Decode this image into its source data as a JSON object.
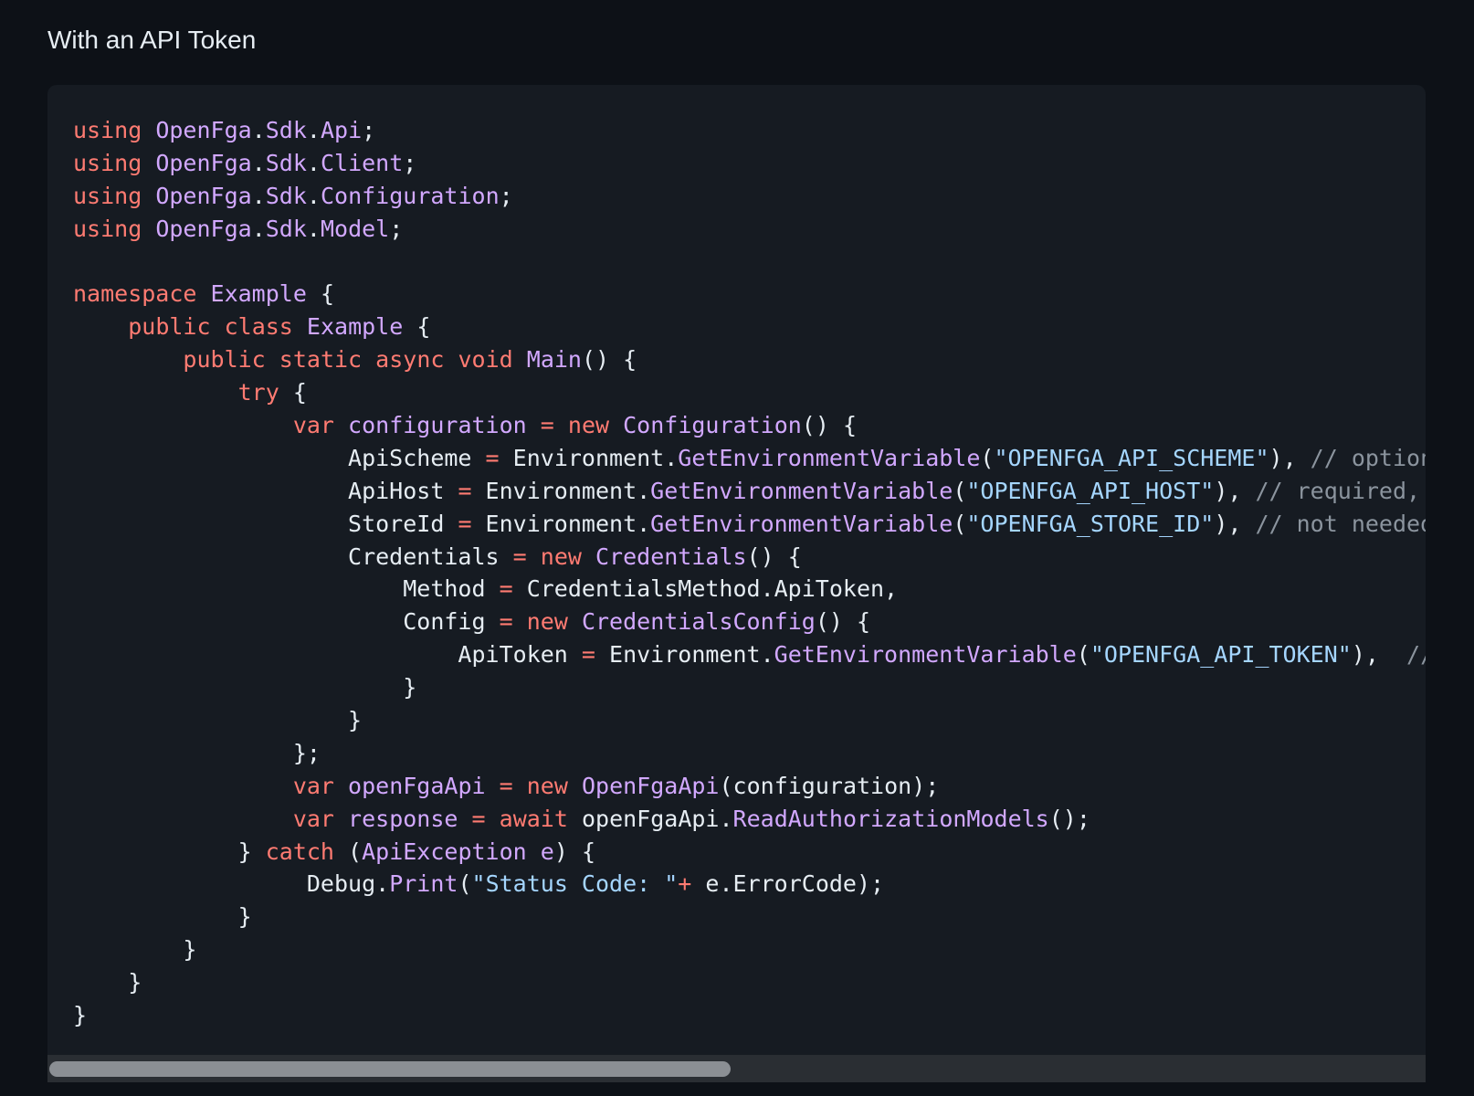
{
  "section_title": "With an API Token",
  "code": {
    "language": "csharp",
    "lines": [
      [
        [
          "kw",
          "using"
        ],
        [
          "pl",
          " "
        ],
        [
          "ty",
          "OpenFga"
        ],
        [
          "pl",
          "."
        ],
        [
          "ty",
          "Sdk"
        ],
        [
          "pl",
          "."
        ],
        [
          "ty",
          "Api"
        ],
        [
          "pl",
          ";"
        ]
      ],
      [
        [
          "kw",
          "using"
        ],
        [
          "pl",
          " "
        ],
        [
          "ty",
          "OpenFga"
        ],
        [
          "pl",
          "."
        ],
        [
          "ty",
          "Sdk"
        ],
        [
          "pl",
          "."
        ],
        [
          "ty",
          "Client"
        ],
        [
          "pl",
          ";"
        ]
      ],
      [
        [
          "kw",
          "using"
        ],
        [
          "pl",
          " "
        ],
        [
          "ty",
          "OpenFga"
        ],
        [
          "pl",
          "."
        ],
        [
          "ty",
          "Sdk"
        ],
        [
          "pl",
          "."
        ],
        [
          "ty",
          "Configuration"
        ],
        [
          "pl",
          ";"
        ]
      ],
      [
        [
          "kw",
          "using"
        ],
        [
          "pl",
          " "
        ],
        [
          "ty",
          "OpenFga"
        ],
        [
          "pl",
          "."
        ],
        [
          "ty",
          "Sdk"
        ],
        [
          "pl",
          "."
        ],
        [
          "ty",
          "Model"
        ],
        [
          "pl",
          ";"
        ]
      ],
      [],
      [
        [
          "kw",
          "namespace"
        ],
        [
          "pl",
          " "
        ],
        [
          "ty",
          "Example"
        ],
        [
          "pl",
          " {"
        ]
      ],
      [
        [
          "pl",
          "    "
        ],
        [
          "kw",
          "public"
        ],
        [
          "pl",
          " "
        ],
        [
          "kw",
          "class"
        ],
        [
          "pl",
          " "
        ],
        [
          "ty",
          "Example"
        ],
        [
          "pl",
          " {"
        ]
      ],
      [
        [
          "pl",
          "        "
        ],
        [
          "kw",
          "public"
        ],
        [
          "pl",
          " "
        ],
        [
          "kw",
          "static"
        ],
        [
          "pl",
          " "
        ],
        [
          "kw",
          "async"
        ],
        [
          "pl",
          " "
        ],
        [
          "kw",
          "void"
        ],
        [
          "pl",
          " "
        ],
        [
          "fn",
          "Main"
        ],
        [
          "pl",
          "() {"
        ]
      ],
      [
        [
          "pl",
          "            "
        ],
        [
          "kw",
          "try"
        ],
        [
          "pl",
          " {"
        ]
      ],
      [
        [
          "pl",
          "                "
        ],
        [
          "kw",
          "var"
        ],
        [
          "pl",
          " "
        ],
        [
          "ty",
          "configuration"
        ],
        [
          "pl",
          " "
        ],
        [
          "op",
          "="
        ],
        [
          "pl",
          " "
        ],
        [
          "kw",
          "new"
        ],
        [
          "pl",
          " "
        ],
        [
          "fn",
          "Configuration"
        ],
        [
          "pl",
          "() {"
        ]
      ],
      [
        [
          "pl",
          "                    ApiScheme "
        ],
        [
          "op",
          "="
        ],
        [
          "pl",
          " Environment."
        ],
        [
          "fn",
          "GetEnvironmentVariable"
        ],
        [
          "pl",
          "("
        ],
        [
          "st",
          "\"OPENFGA_API_SCHEME\""
        ],
        [
          "pl",
          "), "
        ],
        [
          "cm",
          "// optional, defaults to \"https\""
        ]
      ],
      [
        [
          "pl",
          "                    ApiHost "
        ],
        [
          "op",
          "="
        ],
        [
          "pl",
          " Environment."
        ],
        [
          "fn",
          "GetEnvironmentVariable"
        ],
        [
          "pl",
          "("
        ],
        [
          "st",
          "\"OPENFGA_API_HOST\""
        ],
        [
          "pl",
          "), "
        ],
        [
          "cm",
          "// required, define without the scheme"
        ]
      ],
      [
        [
          "pl",
          "                    StoreId "
        ],
        [
          "op",
          "="
        ],
        [
          "pl",
          " Environment."
        ],
        [
          "fn",
          "GetEnvironmentVariable"
        ],
        [
          "pl",
          "("
        ],
        [
          "st",
          "\"OPENFGA_STORE_ID\""
        ],
        [
          "pl",
          "), "
        ],
        [
          "cm",
          "// not needed when calling CreateStore"
        ]
      ],
      [
        [
          "pl",
          "                    Credentials "
        ],
        [
          "op",
          "="
        ],
        [
          "pl",
          " "
        ],
        [
          "kw",
          "new"
        ],
        [
          "pl",
          " "
        ],
        [
          "fn",
          "Credentials"
        ],
        [
          "pl",
          "() {"
        ]
      ],
      [
        [
          "pl",
          "                        Method "
        ],
        [
          "op",
          "="
        ],
        [
          "pl",
          " CredentialsMethod.ApiToken,"
        ]
      ],
      [
        [
          "pl",
          "                        Config "
        ],
        [
          "op",
          "="
        ],
        [
          "pl",
          " "
        ],
        [
          "kw",
          "new"
        ],
        [
          "pl",
          " "
        ],
        [
          "fn",
          "CredentialsConfig"
        ],
        [
          "pl",
          "() {"
        ]
      ],
      [
        [
          "pl",
          "                            ApiToken "
        ],
        [
          "op",
          "="
        ],
        [
          "pl",
          " Environment."
        ],
        [
          "fn",
          "GetEnvironmentVariable"
        ],
        [
          "pl",
          "("
        ],
        [
          "st",
          "\"OPENFGA_API_TOKEN\""
        ],
        [
          "pl",
          "),  "
        ],
        [
          "cm",
          "// will be passed as the \"Authorization\" header"
        ]
      ],
      [
        [
          "pl",
          "                        }"
        ]
      ],
      [
        [
          "pl",
          "                    }"
        ]
      ],
      [
        [
          "pl",
          "                };"
        ]
      ],
      [
        [
          "pl",
          "                "
        ],
        [
          "kw",
          "var"
        ],
        [
          "pl",
          " "
        ],
        [
          "ty",
          "openFgaApi"
        ],
        [
          "pl",
          " "
        ],
        [
          "op",
          "="
        ],
        [
          "pl",
          " "
        ],
        [
          "kw",
          "new"
        ],
        [
          "pl",
          " "
        ],
        [
          "fn",
          "OpenFgaApi"
        ],
        [
          "pl",
          "(configuration);"
        ]
      ],
      [
        [
          "pl",
          "                "
        ],
        [
          "kw",
          "var"
        ],
        [
          "pl",
          " "
        ],
        [
          "ty",
          "response"
        ],
        [
          "pl",
          " "
        ],
        [
          "op",
          "="
        ],
        [
          "pl",
          " "
        ],
        [
          "kw",
          "await"
        ],
        [
          "pl",
          " openFgaApi."
        ],
        [
          "fn",
          "ReadAuthorizationModels"
        ],
        [
          "pl",
          "();"
        ]
      ],
      [
        [
          "pl",
          "            } "
        ],
        [
          "kw",
          "catch"
        ],
        [
          "pl",
          " ("
        ],
        [
          "ty",
          "ApiException"
        ],
        [
          "pl",
          " "
        ],
        [
          "ty",
          "e"
        ],
        [
          "pl",
          ") {"
        ]
      ],
      [
        [
          "pl",
          "                 Debug."
        ],
        [
          "fn",
          "Print"
        ],
        [
          "pl",
          "("
        ],
        [
          "st",
          "\"Status Code: \""
        ],
        [
          "op",
          "+"
        ],
        [
          "pl",
          " e.ErrorCode);"
        ]
      ],
      [
        [
          "pl",
          "            }"
        ]
      ],
      [
        [
          "pl",
          "        }"
        ]
      ],
      [
        [
          "pl",
          "    }"
        ]
      ],
      [
        [
          "pl",
          "}"
        ]
      ]
    ]
  },
  "scrollbar": {
    "visible_fraction": 0.49,
    "position": 0
  }
}
